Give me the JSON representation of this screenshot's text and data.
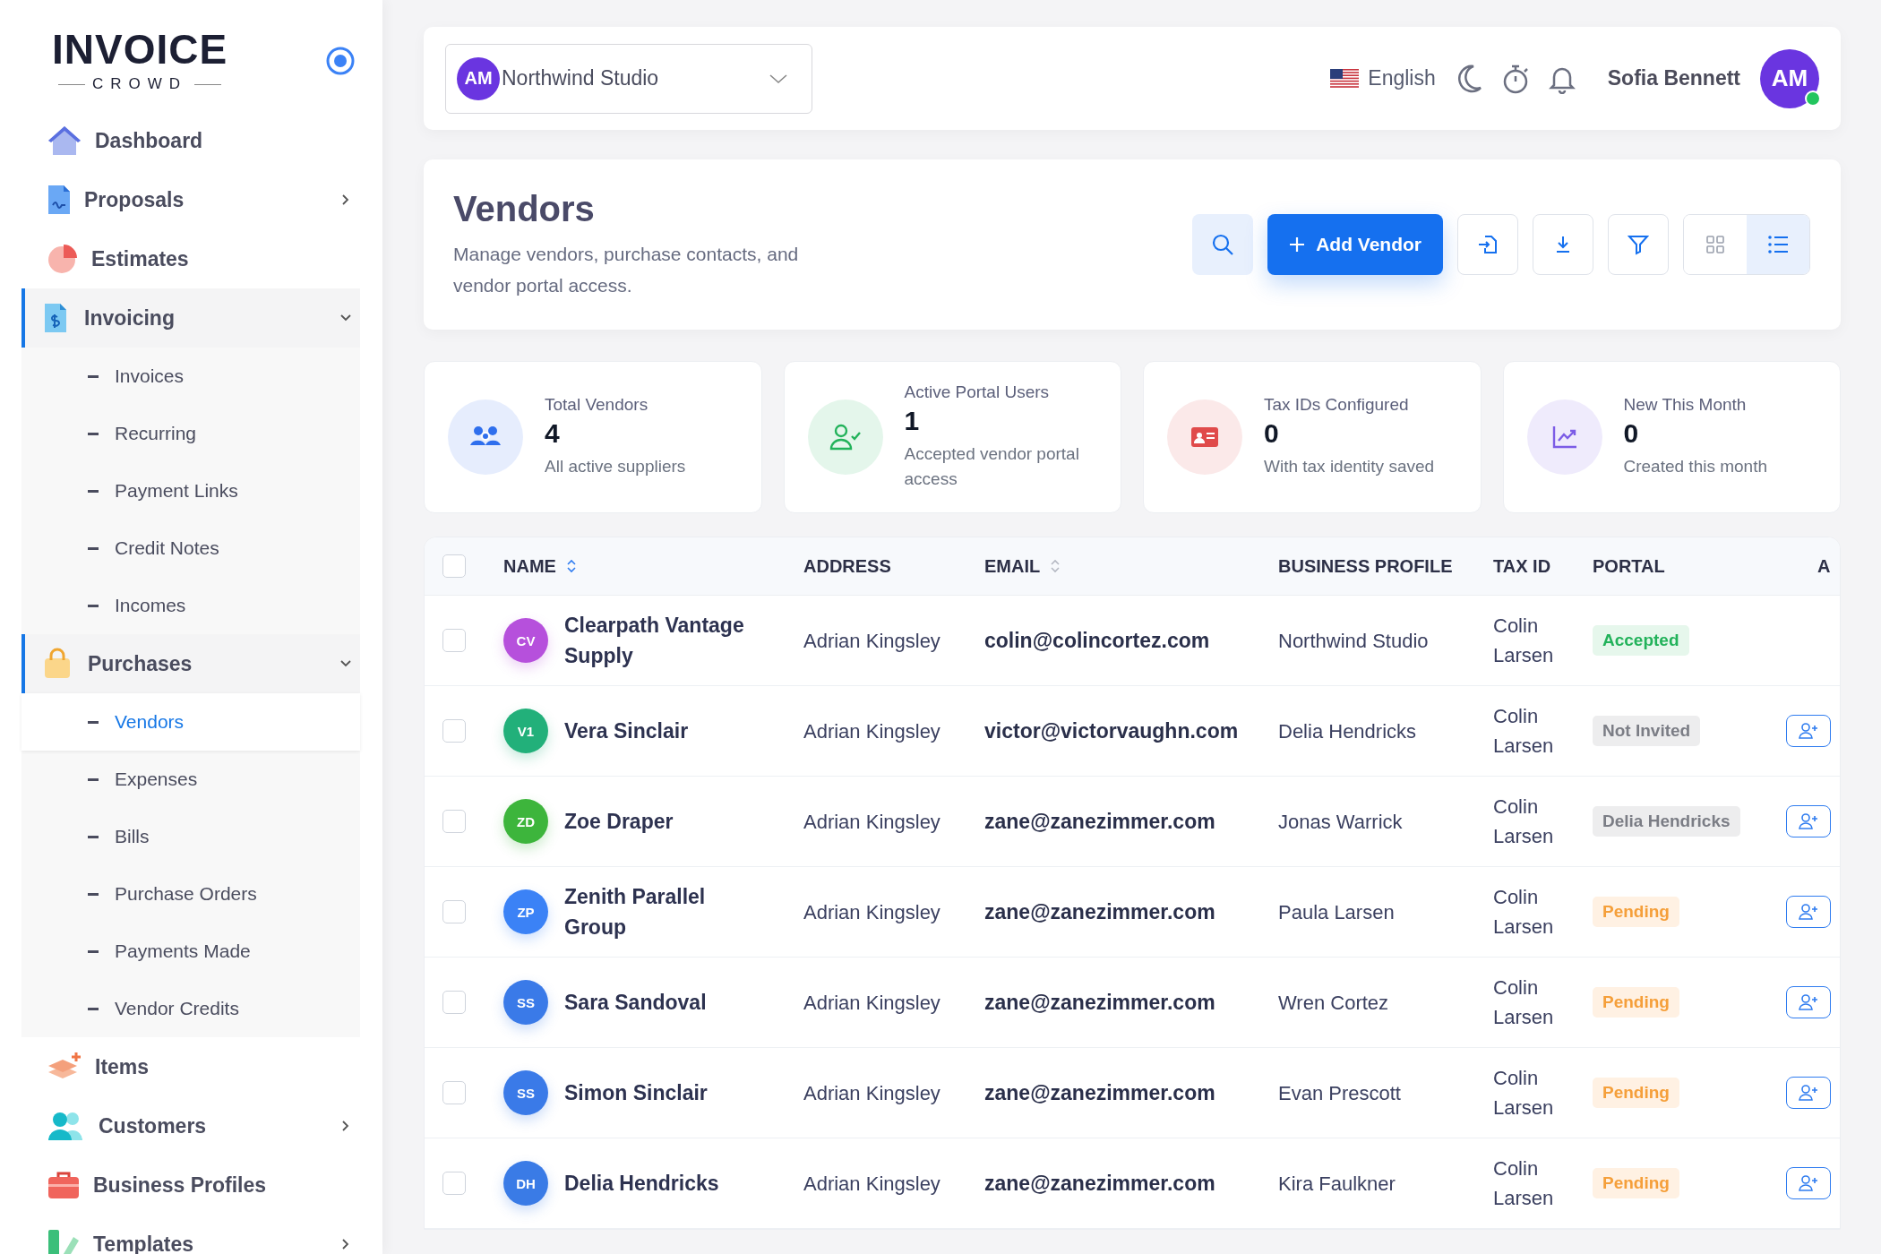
{
  "sidebar": {
    "logo": {
      "title": "INVOICE",
      "subtitle": "CROWD"
    },
    "items": [
      {
        "label": "Dashboard"
      },
      {
        "label": "Proposals",
        "expanded": false
      },
      {
        "label": "Estimates"
      },
      {
        "label": "Invoicing",
        "expanded": true,
        "children": [
          {
            "label": "Invoices",
            "selected": false
          },
          {
            "label": "Recurring",
            "selected": false
          },
          {
            "label": "Payment Links",
            "selected": false
          },
          {
            "label": "Credit Notes",
            "selected": false
          },
          {
            "label": "Incomes",
            "selected": false
          }
        ]
      },
      {
        "label": "Purchases",
        "expanded": true,
        "children": [
          {
            "label": "Vendors",
            "selected": true
          },
          {
            "label": "Expenses",
            "selected": false
          },
          {
            "label": "Bills",
            "selected": false
          },
          {
            "label": "Purchase Orders",
            "selected": false
          },
          {
            "label": "Payments Made",
            "selected": false
          },
          {
            "label": "Vendor Credits",
            "selected": false
          }
        ]
      },
      {
        "label": "Items"
      },
      {
        "label": "Customers",
        "expanded": false
      },
      {
        "label": "Business Profiles"
      },
      {
        "label": "Templates",
        "expanded": false
      }
    ]
  },
  "header": {
    "company": {
      "initials": "AM",
      "name": "Northwind Studio"
    },
    "language": "English",
    "user": {
      "name": "Sofia Bennett",
      "initials": "AM",
      "online": true
    }
  },
  "page": {
    "title": "Vendors",
    "description": "Manage vendors, purchase contacts, and vendor portal access.",
    "add_button": "Add Vendor",
    "view_modes": [
      {
        "selected": false
      },
      {
        "selected": true
      }
    ]
  },
  "stats": [
    {
      "label": "Total Vendors",
      "value": "4",
      "note": "All active suppliers",
      "color": "#2f6fed"
    },
    {
      "label": "Active Portal Users",
      "value": "1",
      "note": "Accepted vendor portal access",
      "color": "#22b25a"
    },
    {
      "label": "Tax IDs Configured",
      "value": "0",
      "note": "With tax identity saved",
      "color": "#e04b4b"
    },
    {
      "label": "New This Month",
      "value": "0",
      "note": "Created this month",
      "color": "#7c5ce6"
    }
  ],
  "table": {
    "all_selected": false,
    "columns": [
      {
        "label": "NAME",
        "sorted": true
      },
      {
        "label": "ADDRESS"
      },
      {
        "label": "EMAIL",
        "sorted": false
      },
      {
        "label": "BUSINESS PROFILE"
      },
      {
        "label": "TAX ID"
      },
      {
        "label": "PORTAL"
      },
      {
        "label": "A"
      }
    ],
    "rows": [
      {
        "selected": false,
        "initials": "CV",
        "color": "#b650dc",
        "name": "Clearpath Vantage Supply",
        "address": "Adrian Kingsley",
        "email": "colin@colincortez.com",
        "business_profile": "Northwind Studio",
        "tax_id": "Colin Larsen",
        "portal": {
          "label": "Accepted",
          "kind": "success"
        },
        "invite": false
      },
      {
        "selected": false,
        "initials": "V1",
        "color": "#22b07a",
        "name": "Vera Sinclair",
        "address": "Adrian Kingsley",
        "email": "victor@victorvaughn.com",
        "business_profile": "Delia Hendricks",
        "tax_id": "Colin Larsen",
        "portal": {
          "label": "Not Invited",
          "kind": "muted"
        },
        "invite": true
      },
      {
        "selected": false,
        "initials": "ZD",
        "color": "#3db53c",
        "name": "Zoe Draper",
        "address": "Adrian Kingsley",
        "email": "zane@zanezimmer.com",
        "business_profile": "Jonas Warrick",
        "tax_id": "Colin Larsen",
        "portal": {
          "label": "Delia Hendricks",
          "kind": "muted"
        },
        "invite": true
      },
      {
        "selected": false,
        "initials": "ZP",
        "color": "#3b82f6",
        "name": "Zenith Parallel Group",
        "address": "Adrian Kingsley",
        "email": "zane@zanezimmer.com",
        "business_profile": "Paula Larsen",
        "tax_id": "Colin Larsen",
        "portal": {
          "label": "Pending",
          "kind": "warning"
        },
        "invite": true
      },
      {
        "selected": false,
        "initials": "SS",
        "color": "#3a7ae8",
        "name": "Sara Sandoval",
        "address": "Adrian Kingsley",
        "email": "zane@zanezimmer.com",
        "business_profile": "Wren Cortez",
        "tax_id": "Colin Larsen",
        "portal": {
          "label": "Pending",
          "kind": "warning"
        },
        "invite": true
      },
      {
        "selected": false,
        "initials": "SS",
        "color": "#3a7ae8",
        "name": "Simon Sinclair",
        "address": "Adrian Kingsley",
        "email": "zane@zanezimmer.com",
        "business_profile": "Evan Prescott",
        "tax_id": "Colin Larsen",
        "portal": {
          "label": "Pending",
          "kind": "warning"
        },
        "invite": true
      },
      {
        "selected": false,
        "initials": "DH",
        "color": "#3a7be6",
        "name": "Delia Hendricks",
        "address": "Adrian Kingsley",
        "email": "zane@zanezimmer.com",
        "business_profile": "Kira Faulkner",
        "tax_id": "Colin Larsen",
        "portal": {
          "label": "Pending",
          "kind": "warning"
        },
        "invite": true
      }
    ]
  }
}
